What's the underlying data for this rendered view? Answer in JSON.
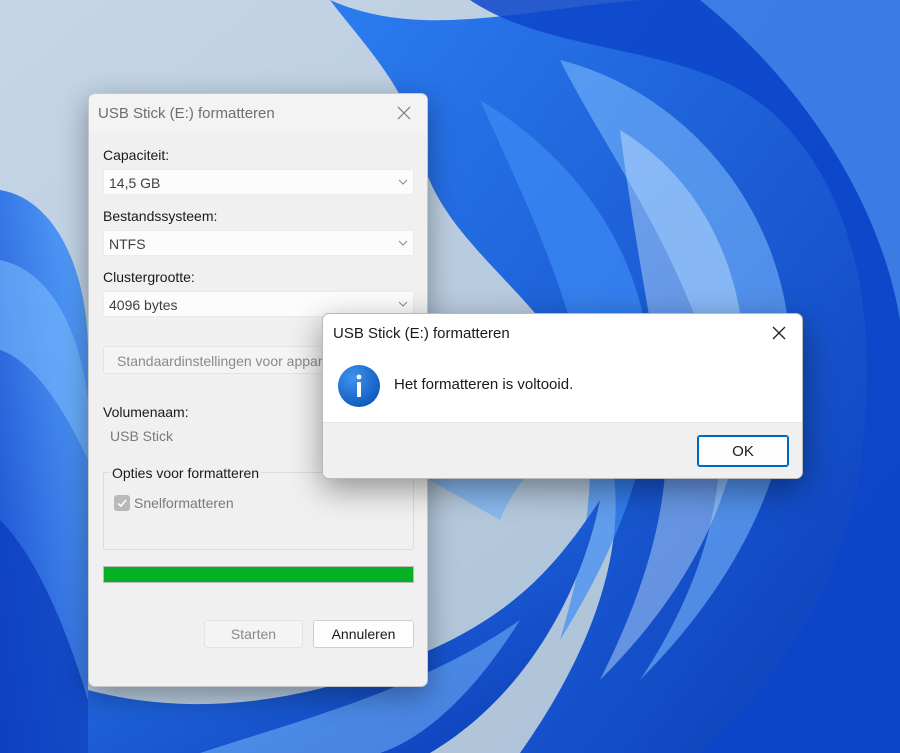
{
  "format_dialog": {
    "title": "USB Stick (E:) formatteren",
    "capacity": {
      "label": "Capaciteit:",
      "value": "14,5 GB"
    },
    "file_system": {
      "label": "Bestandssysteem:",
      "value": "NTFS"
    },
    "cluster_size": {
      "label": "Clustergrootte:",
      "value": "4096 bytes"
    },
    "restore_defaults_label": "Standaardinstellingen voor apparaat herstellen",
    "volume_name": {
      "label": "Volumenaam:",
      "value": "USB Stick"
    },
    "format_options": {
      "legend": "Opties voor formatteren",
      "quick_format_label": "Snelformatteren",
      "quick_format_checked": true
    },
    "progress_percent": 100,
    "start_label": "Starten",
    "cancel_label": "Annuleren"
  },
  "message_box": {
    "title": "USB Stick (E:) formatteren",
    "message": "Het formatteren is voltooid.",
    "ok_label": "OK",
    "icon": "info-icon"
  },
  "colors": {
    "progress_green": "#06b025",
    "info_blue": "#0a64c8",
    "focus_border": "#0067c0",
    "wallpaper_blue": "#1a4fd8"
  }
}
